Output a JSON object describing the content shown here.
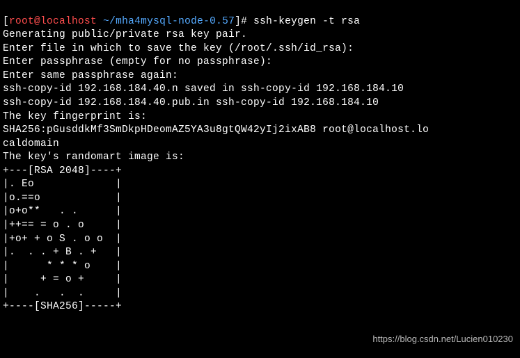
{
  "prompt": {
    "open_bracket": "[",
    "user": "root",
    "at": "@",
    "host": "localhost",
    "space": " ",
    "path": "~/mha4mysql-node-0.57",
    "close_bracket": "]",
    "hash": "# "
  },
  "command": "ssh-keygen -t rsa",
  "output": {
    "l1": "Generating public/private rsa key pair.",
    "l2": "Enter file in which to save the key (/root/.ssh/id_rsa):",
    "l3": "Enter passphrase (empty for no passphrase):",
    "l4": "Enter same passphrase again:",
    "l5": "ssh-copy-id 192.168.184.40.n saved in ssh-copy-id 192.168.184.10",
    "l6": "ssh-copy-id 192.168.184.40.pub.in ssh-copy-id 192.168.184.10",
    "l7": "The key fingerprint is:",
    "l8": "SHA256:pGusddkMf3SmDkpHDeomAZ5YA3u8gtQW42yIj2ixAB8 root@localhost.lo",
    "l9": "caldomain",
    "l10": "The key's randomart image is:",
    "l11": "+---[RSA 2048]----+",
    "l12": "|. Eo             |",
    "l13": "|o.==o            |",
    "l14": "|o+o**   . .      |",
    "l15": "|++== = o . o     |",
    "l16": "|+o+ + o S . o o  |",
    "l17": "|.  . . + B . +   |",
    "l18": "|      * * * o    |",
    "l19": "|     + = o +     |",
    "l20": "|    .   .  .     |",
    "l21": "+----[SHA256]-----+"
  },
  "watermark": "https://blog.csdn.net/Lucien010230"
}
